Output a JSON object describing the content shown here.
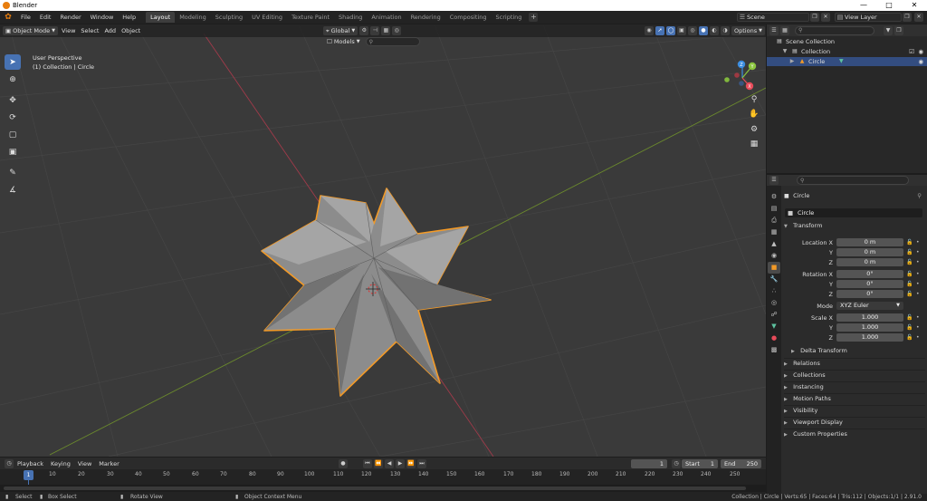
{
  "window": {
    "title": "Blender",
    "controls": [
      "—",
      "□",
      "✕"
    ]
  },
  "menus": [
    "File",
    "Edit",
    "Render",
    "Window",
    "Help"
  ],
  "workspaces": [
    "Layout",
    "Modeling",
    "Sculpting",
    "UV Editing",
    "Texture Paint",
    "Shading",
    "Animation",
    "Rendering",
    "Compositing",
    "Scripting"
  ],
  "active_workspace": "Layout",
  "scene": {
    "scene_name": "Scene",
    "view_layer": "View Layer"
  },
  "viewport": {
    "mode": "Object Mode",
    "menus": [
      "View",
      "Select",
      "Add",
      "Object"
    ],
    "orientation": "Global",
    "options_label": "Options",
    "models_label": "Models",
    "info_line1": "User Perspective",
    "info_line2": "(1) Collection | Circle"
  },
  "gizmo": {
    "axes": [
      "X",
      "Y",
      "Z"
    ],
    "colors": {
      "x": "#e84b5a",
      "y": "#8ac53e",
      "z": "#3b8de0"
    }
  },
  "timeline": {
    "menus": [
      "Playback",
      "Keying",
      "View",
      "Marker"
    ],
    "current_frame": "1",
    "start_label": "Start",
    "start": "1",
    "end_label": "End",
    "end": "250",
    "ticks": [
      "10",
      "20",
      "30",
      "40",
      "50",
      "60",
      "70",
      "80",
      "90",
      "100",
      "110",
      "120",
      "130",
      "140",
      "150",
      "160",
      "170",
      "180",
      "190",
      "200",
      "210",
      "220",
      "230",
      "240",
      "250"
    ],
    "cursor_frame": "1"
  },
  "statusbar": {
    "select": "Select",
    "box_select": "Box Select",
    "rotate_view": "Rotate View",
    "context_menu": "Object Context Menu",
    "stats": "Collection | Circle | Verts:65 | Faces:64 | Tris:112 | Objects:1/1 | 2.91.0"
  },
  "outliner": {
    "scene_collection": "Scene Collection",
    "collection": "Collection",
    "object": "Circle"
  },
  "properties": {
    "object_name": "Circle",
    "data_name": "Circle",
    "transform_label": "Transform",
    "location": {
      "label": "Location X",
      "x": "0 m",
      "y": "0 m",
      "z": "0 m"
    },
    "rotation": {
      "label": "Rotation X",
      "x": "0°",
      "y": "0°",
      "z": "0°"
    },
    "mode_label": "Mode",
    "mode_value": "XYZ Euler",
    "scale": {
      "label": "Scale X",
      "x": "1.000",
      "y": "1.000",
      "z": "1.000"
    },
    "axis_y": "Y",
    "axis_z": "Z",
    "delta_transform": "Delta Transform",
    "panels": [
      "Relations",
      "Collections",
      "Instancing",
      "Motion Paths",
      "Visibility",
      "Viewport Display",
      "Custom Properties"
    ]
  },
  "colors": {
    "accent": "#4772b3",
    "selection": "#f39a27",
    "background": "#3a3a3a"
  }
}
